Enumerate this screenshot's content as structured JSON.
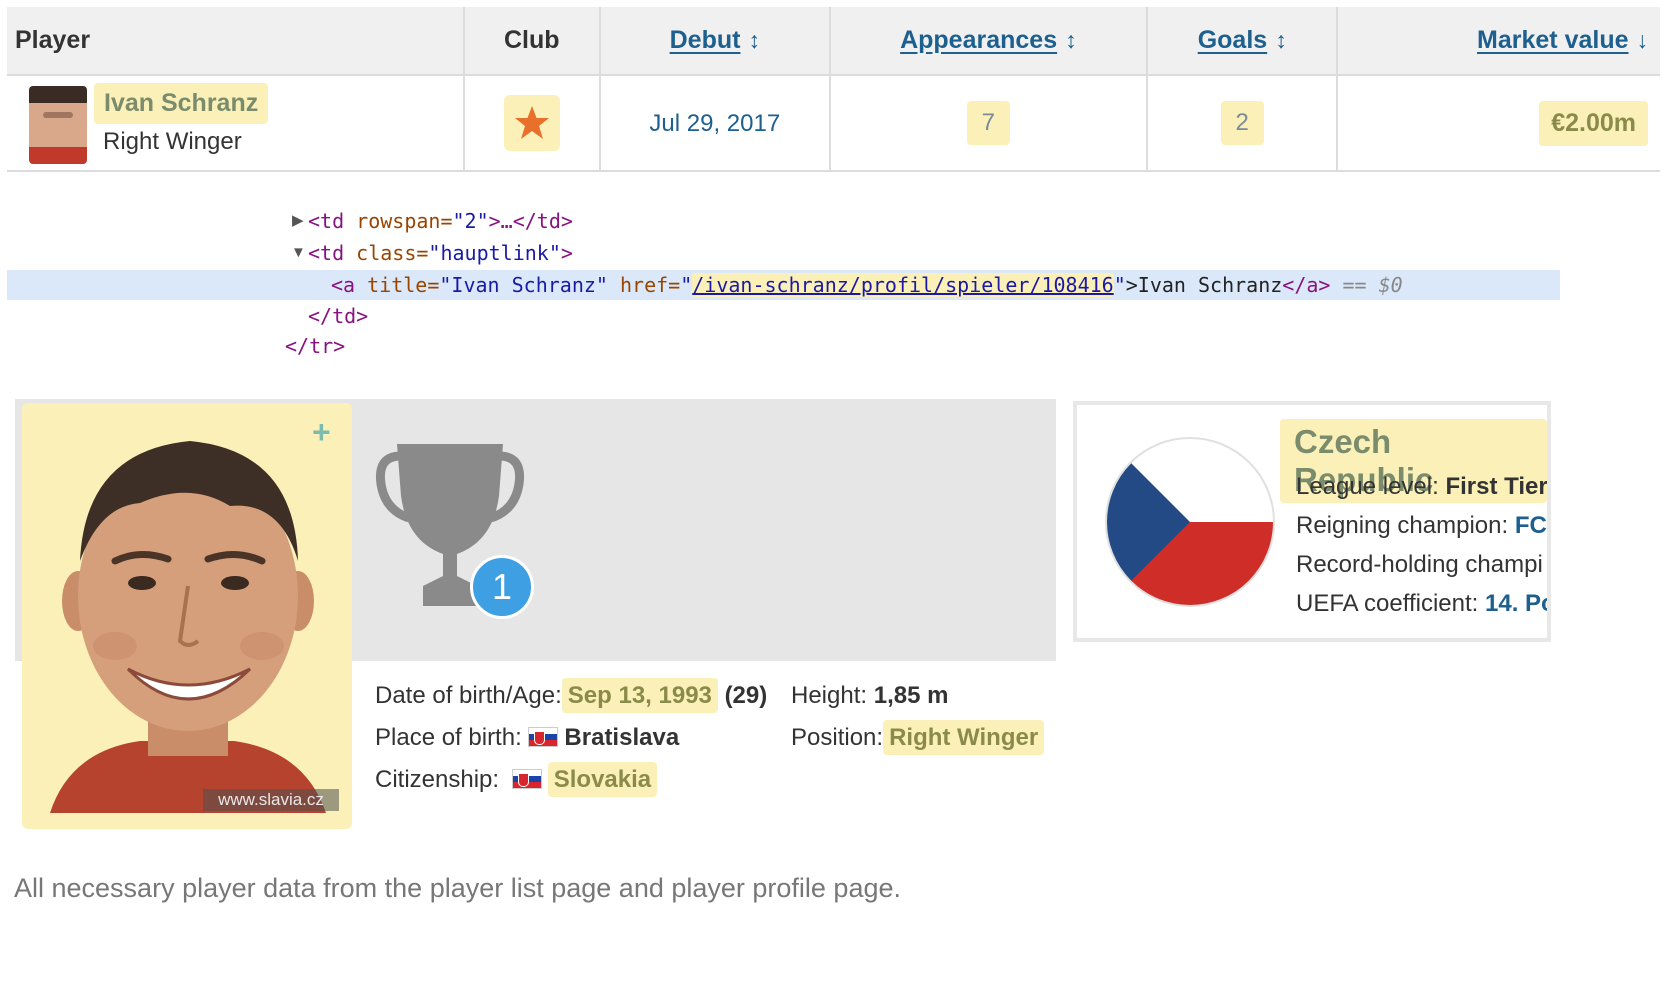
{
  "table": {
    "headers": {
      "player": "Player",
      "club": "Club",
      "debut": "Debut",
      "appearances": "Appearances",
      "goals": "Goals",
      "market_value": "Market value"
    },
    "sort_icons": {
      "debut": "↕",
      "appearances": "↕",
      "goals": "↕",
      "market_value": "↓"
    },
    "row": {
      "name": "Ivan Schranz",
      "position": "Right Winger",
      "debut": "Jul 29, 2017",
      "appearances": "7",
      "goals": "2",
      "market_value": "€2.00m"
    }
  },
  "devtools": {
    "line1_tag_open": "<td",
    "line1_attr": " rowspan=",
    "line1_val": "\"2\"",
    "line1_rest": ">…</td>",
    "line2_tag_open": "<td",
    "line2_attr": " class=",
    "line2_val": "\"hauptlink\"",
    "line2_close": ">",
    "line3_tag_open": "<a",
    "line3_attr_title": " title=",
    "line3_title_val": "\"Ivan Schranz\"",
    "line3_attr_href": " href=",
    "line3_quote_open": "\"",
    "line3_href": "/ivan-schranz/profil/spieler/108416",
    "line3_quote_close": "\"",
    "line3_text": ">Ivan Schranz",
    "line3_tag_close": "</a>",
    "line3_eq": " == ",
    "line3_dollar": "$0",
    "line4": "</td>",
    "line5": "</tr>"
  },
  "profile": {
    "photo_credit": "www.slavia.cz",
    "trophy_count": "1",
    "dob_label": "Date of birth/Age:",
    "dob_value": "Sep 13, 1993",
    "age": "(29)",
    "height_label": "Height:",
    "height_value": "1,85 m",
    "pob_label": "Place of birth:",
    "pob_value": "Bratislava",
    "position_label": "Position:",
    "position_value": "Right Winger",
    "citizenship_label": "Citizenship:",
    "citizenship_value": "Slovakia"
  },
  "league": {
    "country": "Czech Republic",
    "level_label": "League level:",
    "level_value": "First Tier",
    "champion_label": "Reigning champion:",
    "champion_value": "FC",
    "record_label": "Record-holding champi",
    "uefa_label": "UEFA coefficient:",
    "uefa_value": "14. Po"
  },
  "caption": "All necessary player data from the player list page and player profile page.",
  "colors": {
    "highlight": "#fbf1b8",
    "link": "#1d5f8e",
    "badge_blue": "#3ea0e3",
    "devtools_selection": "#dbe8f9"
  },
  "icons": {
    "club": "star-club-badge-icon",
    "plus": "plus-icon",
    "trophy": "trophy-icon",
    "sort": "sort-arrows-icon",
    "flag_sk": "slovakia-flag-icon",
    "flag_cz": "czech-flag-icon"
  }
}
